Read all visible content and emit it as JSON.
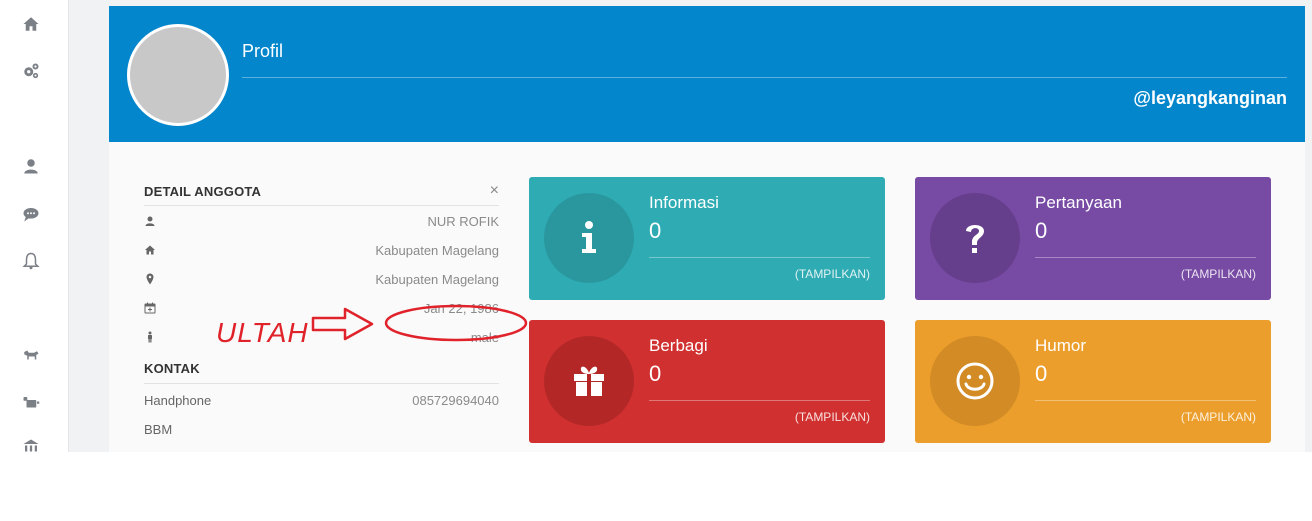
{
  "sidebar": {
    "icons": [
      "home-icon",
      "gears-icon",
      "user-icon",
      "chat-icon",
      "bell-icon",
      "bull-icon",
      "sd-icon",
      "bank-icon"
    ]
  },
  "header": {
    "title": "Profil",
    "username": "@leyangkanginan"
  },
  "detail": {
    "title": "DETAIL ANGGOTA",
    "close": "×",
    "rows": [
      {
        "icon": "user-icon",
        "value": "NUR ROFIK"
      },
      {
        "icon": "home-icon",
        "value": "Kabupaten Magelang"
      },
      {
        "icon": "map-marker-icon",
        "value": "Kabupaten Magelang"
      },
      {
        "icon": "calendar-icon",
        "value": "Jan 22, 1986"
      },
      {
        "icon": "person-icon",
        "value": "male"
      }
    ]
  },
  "kontak": {
    "title": "KONTAK",
    "rows": [
      {
        "label": "Handphone",
        "value": "085729694040"
      },
      {
        "label": "BBM",
        "value": ""
      }
    ]
  },
  "cards": [
    {
      "title": "Informasi",
      "count": "0",
      "link": "(TAMPILKAN)",
      "icon": "info-icon",
      "color": "#2fabb3",
      "circle": "#2a979e"
    },
    {
      "title": "Pertanyaan",
      "count": "0",
      "link": "(TAMPILKAN)",
      "icon": "question-icon",
      "color": "#774aa4",
      "circle": "#653f8c"
    },
    {
      "title": "Berbagi",
      "count": "0",
      "link": "(TAMPILKAN)",
      "icon": "gift-icon",
      "color": "#d0302f",
      "circle": "#b32827"
    },
    {
      "title": "Humor",
      "count": "0",
      "link": "(TAMPILKAN)",
      "icon": "smile-icon",
      "color": "#ec9e2c",
      "circle": "#d28b25"
    }
  ],
  "annotation": {
    "label": "ULTAH",
    "color": "#e0222a"
  }
}
